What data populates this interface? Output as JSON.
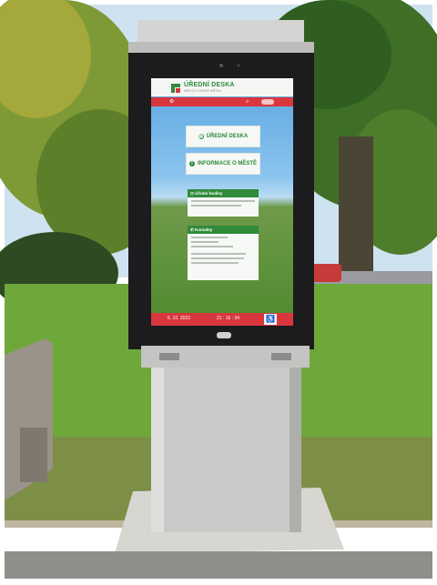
{
  "screen": {
    "header": {
      "title": "ÚŘEDNÍ DESKA",
      "subtitle": "MĚSTO HORNÍ BŘÍZA"
    },
    "nav_icons": [
      "settings-icon",
      "search-icon",
      "toggle-icon"
    ],
    "buttons": [
      {
        "label": "ÚŘEDNÍ DESKA",
        "icon": "notice-board-icon"
      },
      {
        "label": "INFORMACE O MĚSTĚ",
        "icon": "info-icon"
      }
    ],
    "cards": [
      {
        "title": "Úřední hodiny",
        "icon": "clock-icon"
      },
      {
        "title": "Kontakty",
        "icon": "contact-icon"
      }
    ],
    "footer": {
      "date": "6. 10. 2022",
      "time": "21 : 16 : 34",
      "accessibility_icon": "wheelchair-icon"
    }
  },
  "kiosk": {
    "brand_icon": "manufacturer-logo-icon"
  },
  "colors": {
    "brand_green": "#2f8a3a",
    "brand_red": "#d9363e",
    "kiosk_frame": "#1c1c1e",
    "steel": "#c9c9c7"
  }
}
